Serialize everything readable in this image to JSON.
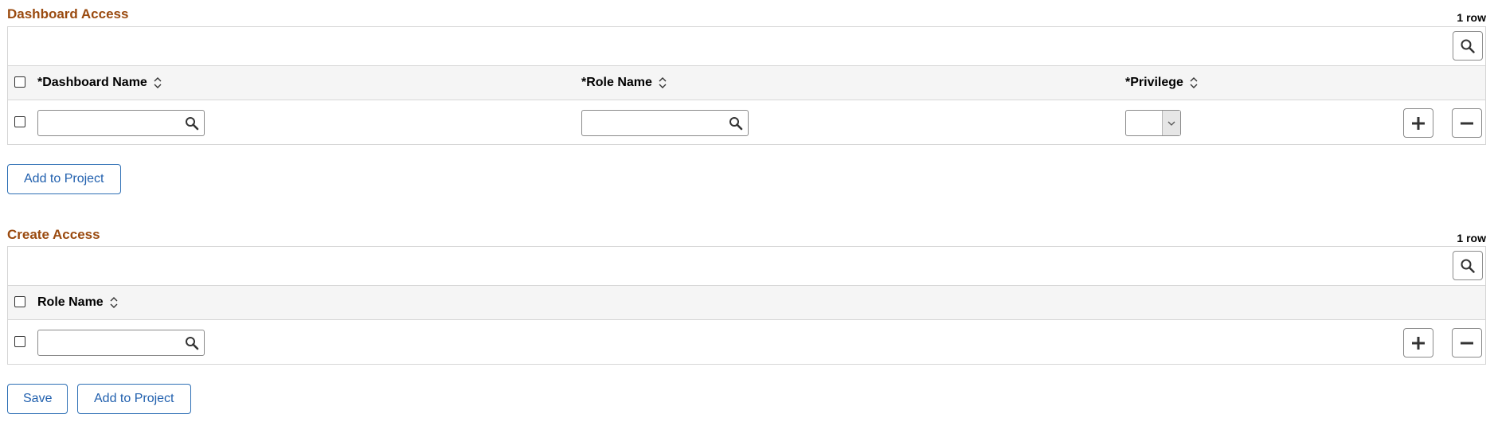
{
  "dashboard_access": {
    "title": "Dashboard Access",
    "row_count": "1 row",
    "columns": {
      "dashboard_name": "*Dashboard Name",
      "role_name": "*Role Name",
      "privilege": "*Privilege"
    },
    "row": {
      "dashboard_name_value": "",
      "role_name_value": "",
      "privilege_value": ""
    },
    "add_to_project_label": "Add to Project"
  },
  "create_access": {
    "title": "Create Access",
    "row_count": "1 row",
    "columns": {
      "role_name": "Role Name"
    },
    "row": {
      "role_name_value": ""
    },
    "save_label": "Save",
    "add_to_project_label": "Add to Project"
  },
  "icons": {
    "grid_search": "search-icon",
    "lookup": "lookup-icon",
    "sort": "sort-icon",
    "add_row": "plus-icon",
    "delete_row": "minus-icon",
    "dropdown": "chevron-down-icon"
  },
  "colors": {
    "section_title": "#9a4a0f",
    "button_text": "#2160ae",
    "button_border": "#2d6fb5",
    "header_bg": "#f5f5f5"
  }
}
